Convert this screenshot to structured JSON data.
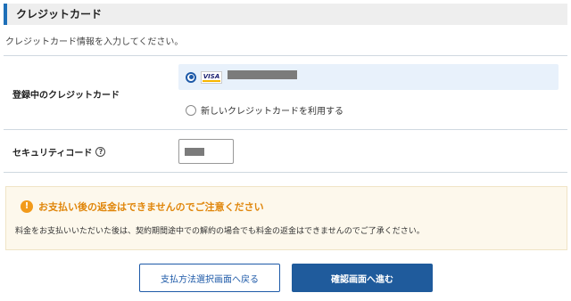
{
  "section": {
    "title": "クレジットカード",
    "intro": "クレジットカード情報を入力してください。"
  },
  "card_row": {
    "label": "登録中のクレジットカード",
    "registered_option": {
      "brand": "VISA",
      "selected": true
    },
    "new_option_label": "新しいクレジットカードを利用する"
  },
  "security_row": {
    "label": "セキュリティコード",
    "help_icon": "question-circle-icon",
    "help_glyph": "?"
  },
  "notice": {
    "icon": "warning-icon",
    "icon_glyph": "!",
    "title": "お支払い後の返金はできませんのでご注意ください",
    "body": "料金をお支払いいただいた後は、契約期間途中での解約の場合でも料金の返金はできませんのでご了承ください。"
  },
  "buttons": {
    "back_label": "支払方法選択画面へ戻る",
    "next_label": "確認画面へ進む"
  },
  "colors": {
    "accent": "#1e6fb8",
    "primary_button": "#1f5b9c",
    "notice_title": "#e0860b",
    "notice_bg": "#fdf8ec"
  }
}
